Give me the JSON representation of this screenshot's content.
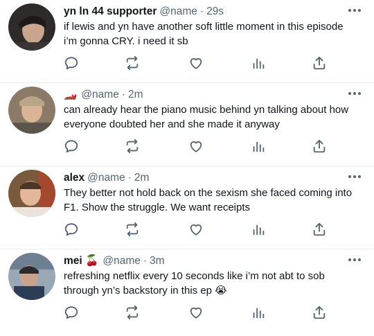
{
  "tweets": [
    {
      "name": "yn ln 44 supporter",
      "handle": "@name",
      "time": "29s",
      "text": "if lewis and yn have another soft little moment in this episode i’m gonna CRY. i need it sb",
      "avatar_colors": [
        "#2e2b2a",
        "#caa58e"
      ]
    },
    {
      "name_emoji": "🏎️",
      "handle": "@name",
      "time": "2m",
      "text": "can already hear the piano music behind yn talking about how everyone doubted her and she made it anyway",
      "avatar_colors": [
        "#8b7a66",
        "#d9b596"
      ]
    },
    {
      "name": "alex",
      "handle": "@name",
      "time": "2m",
      "text": "They better not hold back on the sexism she faced coming into F1. Show the struggle. We want receipts",
      "avatar_colors": [
        "#7a5a3c",
        "#e3b79a"
      ]
    },
    {
      "name": "mei",
      "name_emoji": "🍒",
      "handle": "@name",
      "time": "3m",
      "text": "refreshing netflix every 10 seconds like i’m not abt to sob through yn’s backstory in this ep 😭",
      "avatar_colors": [
        "#3e4f63",
        "#c9a38a"
      ]
    }
  ],
  "icons": {
    "reply": "reply-icon",
    "retweet": "retweet-icon",
    "like": "like-icon",
    "stats": "stats-icon",
    "share": "share-icon",
    "more": "more-icon"
  },
  "colors": {
    "icon": "#536471",
    "text": "#0f1419",
    "secondary": "#536471",
    "divider": "#e6ecf0"
  }
}
